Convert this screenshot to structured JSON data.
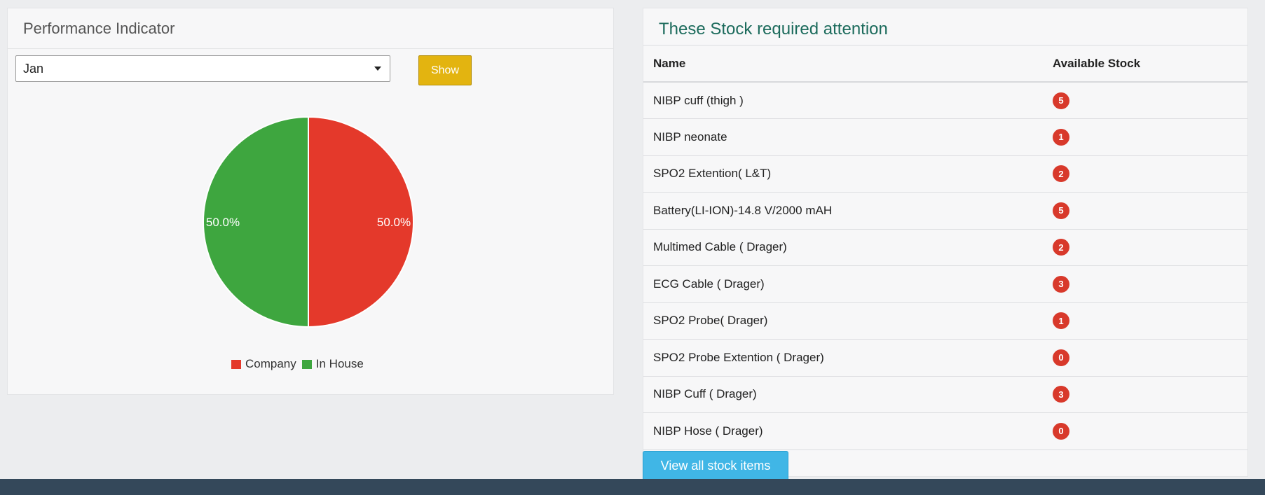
{
  "performance": {
    "title": "Performance Indicator",
    "month_value": "Jan",
    "show_label": "Show"
  },
  "chart_data": {
    "type": "pie",
    "slices": [
      {
        "name": "Company",
        "value": 50.0,
        "label": "50.0%",
        "color": "#e4392b"
      },
      {
        "name": "In House",
        "value": 50.0,
        "label": "50.0%",
        "color": "#3ea63f"
      }
    ],
    "legend_placement": "bottom"
  },
  "stock": {
    "title": "These Stock required attention",
    "columns": [
      "Name",
      "Available Stock"
    ],
    "rows": [
      {
        "name": "NIBP cuff (thigh )",
        "count": "5"
      },
      {
        "name": "NIBP neonate",
        "count": "1"
      },
      {
        "name": "SPO2 Extention( L&T)",
        "count": "2"
      },
      {
        "name": "Battery(LI-ION)-14.8 V/2000 mAH",
        "count": "5"
      },
      {
        "name": "Multimed Cable ( Drager)",
        "count": "2"
      },
      {
        "name": "ECG Cable ( Drager)",
        "count": "3"
      },
      {
        "name": "SPO2 Probe( Drager)",
        "count": "1"
      },
      {
        "name": "SPO2 Probe Extention ( Drager)",
        "count": "0"
      },
      {
        "name": "NIBP Cuff ( Drager)",
        "count": "3"
      },
      {
        "name": "NIBP Hose ( Drager)",
        "count": "0"
      }
    ],
    "view_all_label": "View all stock items"
  },
  "colors": {
    "accent_yellow": "#e3b410",
    "badge_red": "#d8392b",
    "view_button": "#40b6e6",
    "title_green": "#1c6b5c",
    "footer": "#34485a"
  }
}
